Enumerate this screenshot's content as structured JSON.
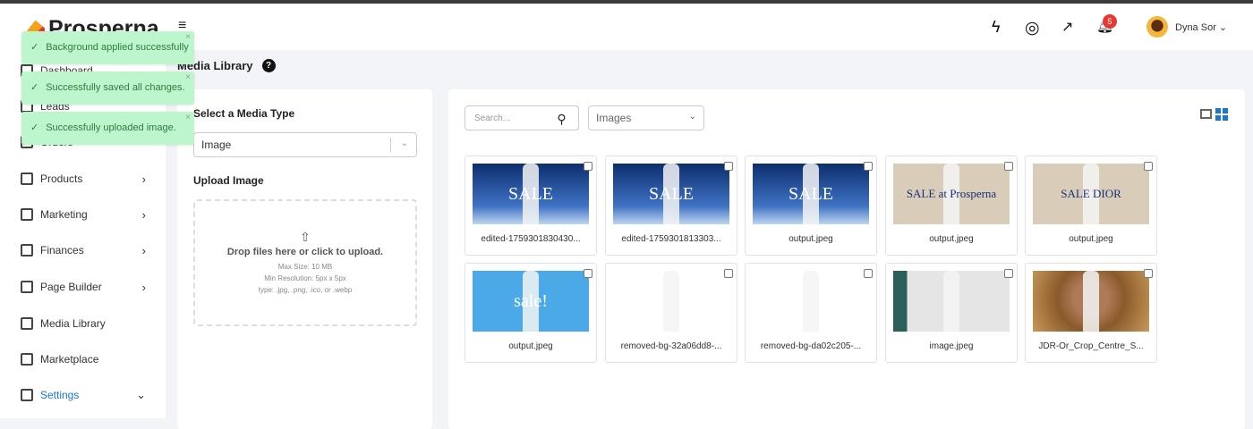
{
  "brand": "Prosperna",
  "header": {
    "notification_count": "5",
    "user_name": "Dyna Sor"
  },
  "sidebar": {
    "items": [
      {
        "label": "Dashboard",
        "icon": "dashboard-icon"
      },
      {
        "label": "Leads",
        "icon": "leads-icon"
      },
      {
        "label": "Orders",
        "icon": "orders-icon"
      },
      {
        "label": "Products",
        "icon": "products-icon",
        "chevron": "›"
      },
      {
        "label": "Marketing",
        "icon": "megaphone-icon",
        "chevron": "›"
      },
      {
        "label": "Finances",
        "icon": "finances-icon",
        "chevron": "›"
      },
      {
        "label": "Page Builder",
        "icon": "page-builder-icon",
        "chevron": "›"
      },
      {
        "label": "Media Library",
        "icon": "media-icon"
      },
      {
        "label": "Marketplace",
        "icon": "marketplace-icon"
      },
      {
        "label": "Settings",
        "icon": "gear-icon",
        "chevron": "⌄"
      }
    ]
  },
  "page": {
    "title": "Media Library"
  },
  "upload": {
    "type_label": "Select a Media Type",
    "type_value": "Image",
    "upload_label": "Upload Image",
    "drop_text": "Drop files here or click to upload.",
    "max_size": "Max Size: 10 MB",
    "min_res": "Min Resolution: 5px x 5px",
    "types": "type: .jpg, .png, .ico, or .webp"
  },
  "library": {
    "search_placeholder": "Search...",
    "filter_value": "Images",
    "items": [
      {
        "name": "edited-1759301830430...",
        "bg": "linear-gradient(180deg,#0d2e6e,#3f72c4 70%,#bcd6f0)",
        "overlay": "SALE"
      },
      {
        "name": "edited-1759301813303...",
        "bg": "linear-gradient(180deg,#0d2e6e,#3f72c4 70%,#bcd6f0)",
        "overlay": "SALE"
      },
      {
        "name": "output.jpeg",
        "bg": "linear-gradient(180deg,#0d2e6e,#3f72c4 70%,#bcd6f0)",
        "overlay": "SALE"
      },
      {
        "name": "output.jpeg",
        "bg": "#d9cdb9",
        "overlay": "SALE at Prosperna"
      },
      {
        "name": "output.jpeg",
        "bg": "#d9cdb9",
        "overlay": "SALE DIOR"
      },
      {
        "name": "output.jpeg",
        "bg": "#4aa9e6",
        "overlay": "sale!"
      },
      {
        "name": "removed-bg-32a06dd8-...",
        "bg": "#fff",
        "overlay": ""
      },
      {
        "name": "removed-bg-da02c205-...",
        "bg": "#fff",
        "overlay": ""
      },
      {
        "name": "image.jpeg",
        "bg": "linear-gradient(90deg,#2d5f5a 0 12%,#e5e5e5 12%)",
        "overlay": ""
      },
      {
        "name": "JDR-Or_Crop_Centre_S...",
        "bg": "radial-gradient(circle at 50% 45%,#b07a5a 25%,#8a5a2a 50%,#c89a5a)",
        "overlay": ""
      }
    ]
  },
  "toasts": [
    "Background applied successfully",
    "Successfully saved all changes.",
    "Successfully uploaded image."
  ],
  "colors": {
    "accent": "#1976d2",
    "toast_bg": "#bdf5cc",
    "badge": "#e53935"
  }
}
